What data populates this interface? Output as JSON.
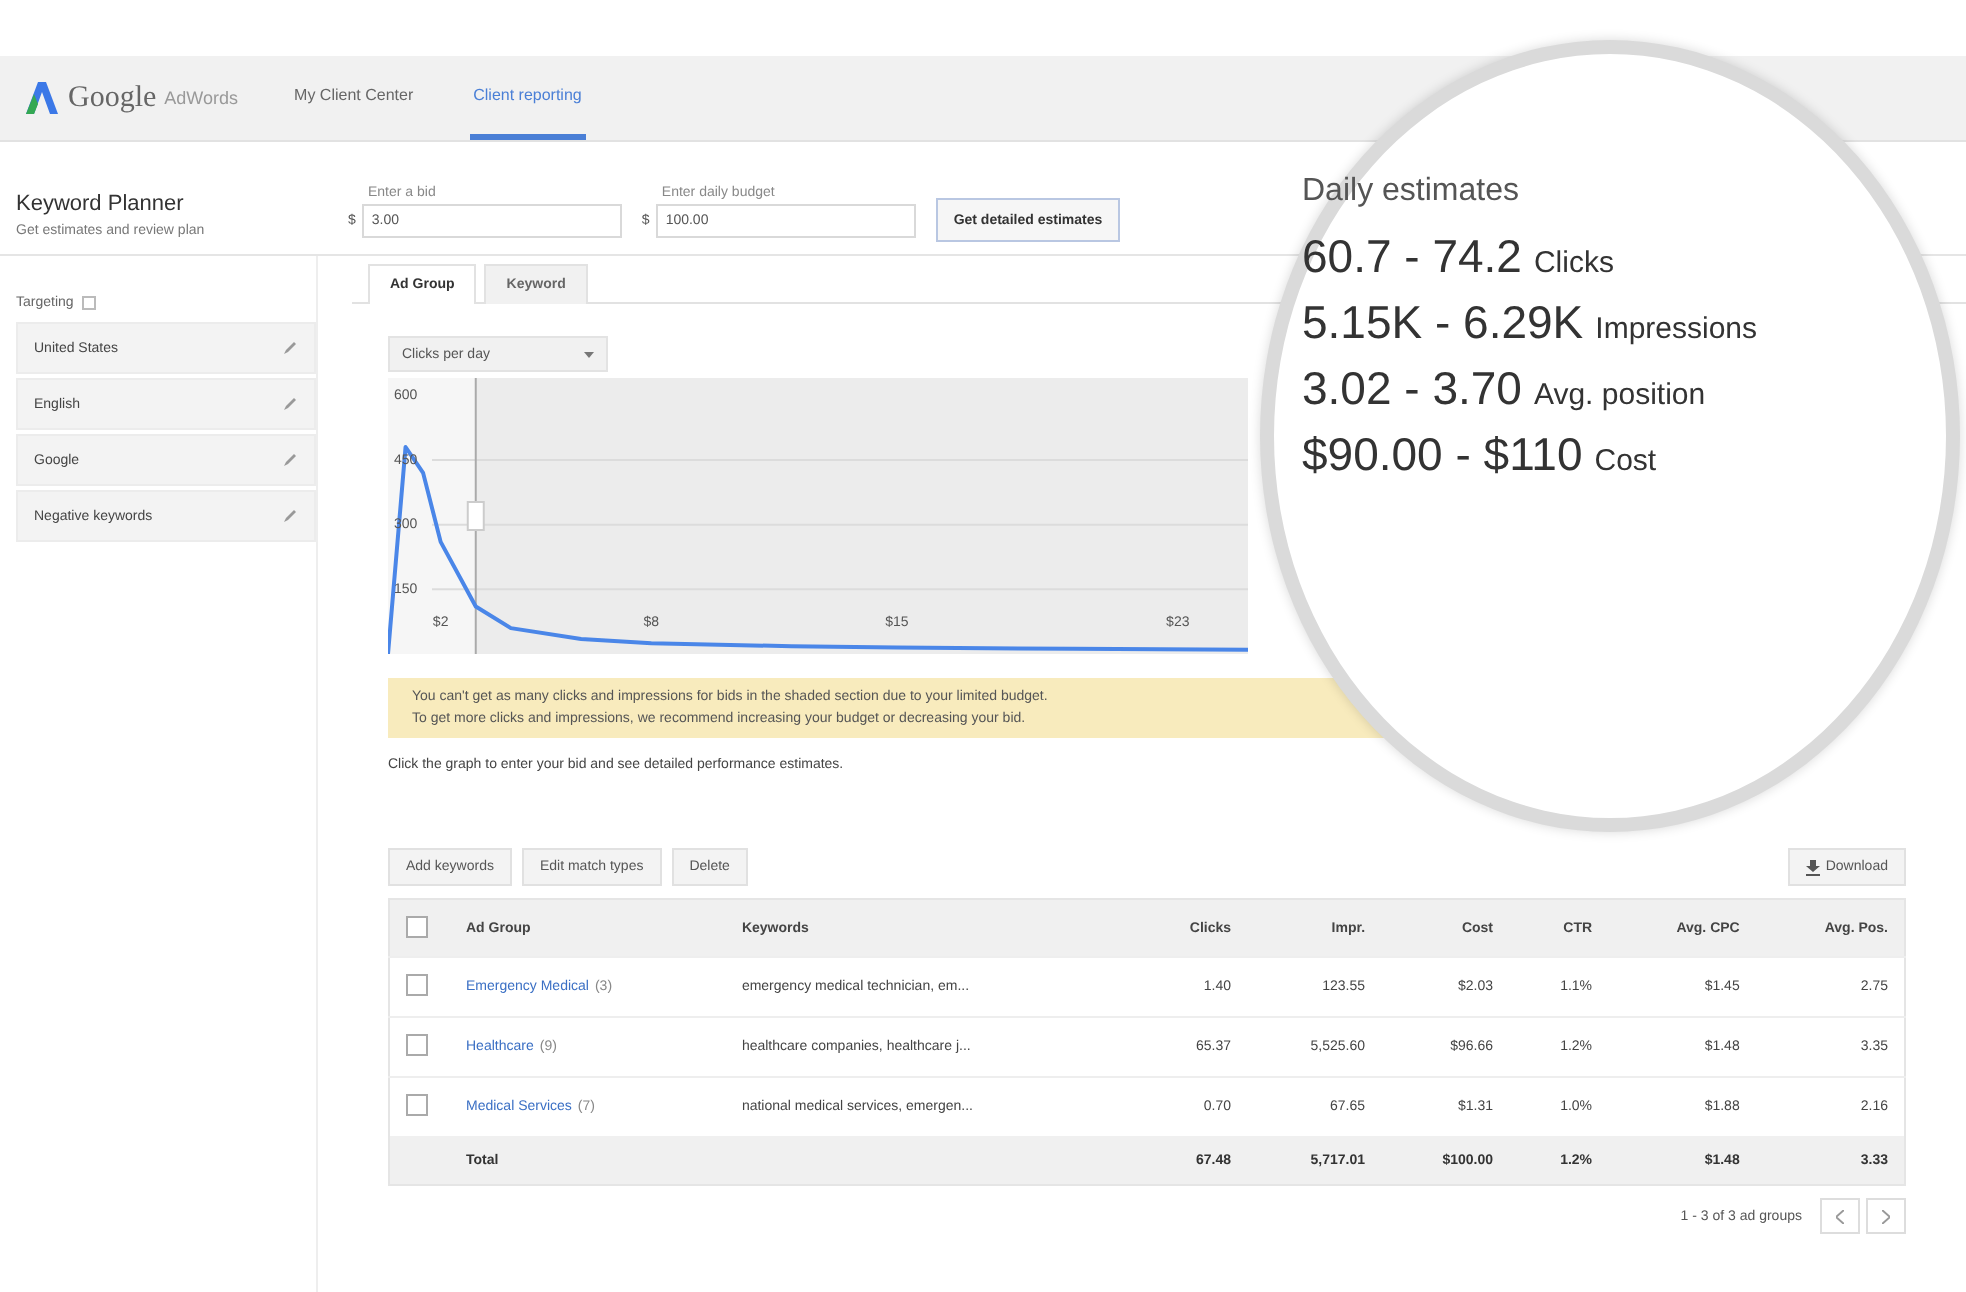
{
  "header": {
    "logo_text": "Google",
    "logo_product": "AdWords",
    "nav": [
      {
        "label": "My Client Center",
        "selected": false
      },
      {
        "label": "Client reporting",
        "selected": true
      }
    ]
  },
  "page": {
    "title": "Keyword Planner",
    "subtitle": "Get estimates and review plan"
  },
  "bid": {
    "label": "Enter a bid",
    "currency": "$",
    "value": "3.00"
  },
  "budget": {
    "label": "Enter daily budget",
    "currency": "$",
    "value": "100.00"
  },
  "estimate_button": "Get detailed estimates",
  "targeting": {
    "title": "Targeting",
    "items": [
      "United States",
      "English",
      "Google",
      "Negative keywords"
    ]
  },
  "tabs": [
    {
      "label": "Ad Group",
      "selected": true
    },
    {
      "label": "Keyword",
      "selected": false
    }
  ],
  "graph": {
    "chart_data": {
      "type": "line",
      "x": [
        0.5,
        1,
        1.5,
        2,
        3,
        4,
        6,
        8,
        12,
        15,
        20,
        25
      ],
      "series": [
        {
          "name": "Clicks per day",
          "color": "#4a86e8",
          "values": [
            0,
            480,
            420,
            260,
            110,
            60,
            35,
            25,
            18,
            15,
            12,
            10
          ]
        }
      ],
      "xlim": [
        0.5,
        25
      ],
      "ylim": [
        0,
        640
      ],
      "xticks": [
        {
          "value": 2,
          "label": "$2"
        },
        {
          "value": 8,
          "label": "$8"
        },
        {
          "value": 15,
          "label": "$15"
        },
        {
          "value": 23,
          "label": "$23"
        }
      ],
      "yticks": [
        600,
        450,
        300,
        150
      ],
      "grid": true,
      "ref_lines": [
        {
          "axis": "x",
          "value": 3
        }
      ],
      "bands": [
        {
          "axis": "x",
          "from": 3,
          "to": 25
        }
      ]
    }
  },
  "warning": [
    "You can't get as many clicks and impressions for bids in the shaded section due to your limited budget.",
    "To get more clicks and impressions, we recommend increasing your budget or decreasing your bid."
  ],
  "instruction": "Click the graph to enter your bid and see detailed performance estimates.",
  "toolbar": {
    "buttons": [
      "Add keywords",
      "Edit match types",
      "Delete"
    ],
    "download": "Download"
  },
  "table": {
    "header_checked": false,
    "columns": [
      "",
      "Ad Group",
      "Keywords",
      "Clicks",
      "Impr.",
      "Cost",
      "CTR",
      "Avg. CPC",
      "Avg. Pos."
    ],
    "rows": [
      {
        "checked": false,
        "count": "(3)",
        "cells": [
          "",
          "Emergency Medical",
          "emergency medical technician, em...",
          "1.40",
          "123.55",
          "$2.03",
          "1.1%",
          "$1.45",
          "2.75"
        ]
      },
      {
        "checked": false,
        "count": "(9)",
        "cells": [
          "",
          "Healthcare",
          "healthcare companies, healthcare j...",
          "65.37",
          "5,525.60",
          "$96.66",
          "1.2%",
          "$1.48",
          "3.35"
        ]
      },
      {
        "checked": false,
        "count": "(7)",
        "cells": [
          "",
          "Medical Services",
          "national medical services, emergen...",
          "0.70",
          "67.65",
          "$1.31",
          "1.0%",
          "$1.88",
          "2.16"
        ]
      },
      {
        "kind": "total",
        "cells": [
          "",
          "Total",
          "",
          "67.48",
          "5,717.01",
          "$100.00",
          "1.2%",
          "$1.48",
          "3.33"
        ]
      }
    ]
  },
  "pagination": "1 - 3 of 3 ad groups",
  "magnifier": {
    "title": "Daily estimates",
    "rows": [
      {
        "value": "60.7 - 74.2",
        "unit": "Clicks"
      },
      {
        "value": "5.15K - 6.29K",
        "unit": "Impressions"
      },
      {
        "value": "3.02 - 3.70",
        "unit": "Avg. position"
      },
      {
        "value": "$90.00 - $110",
        "unit": "Cost"
      }
    ]
  }
}
